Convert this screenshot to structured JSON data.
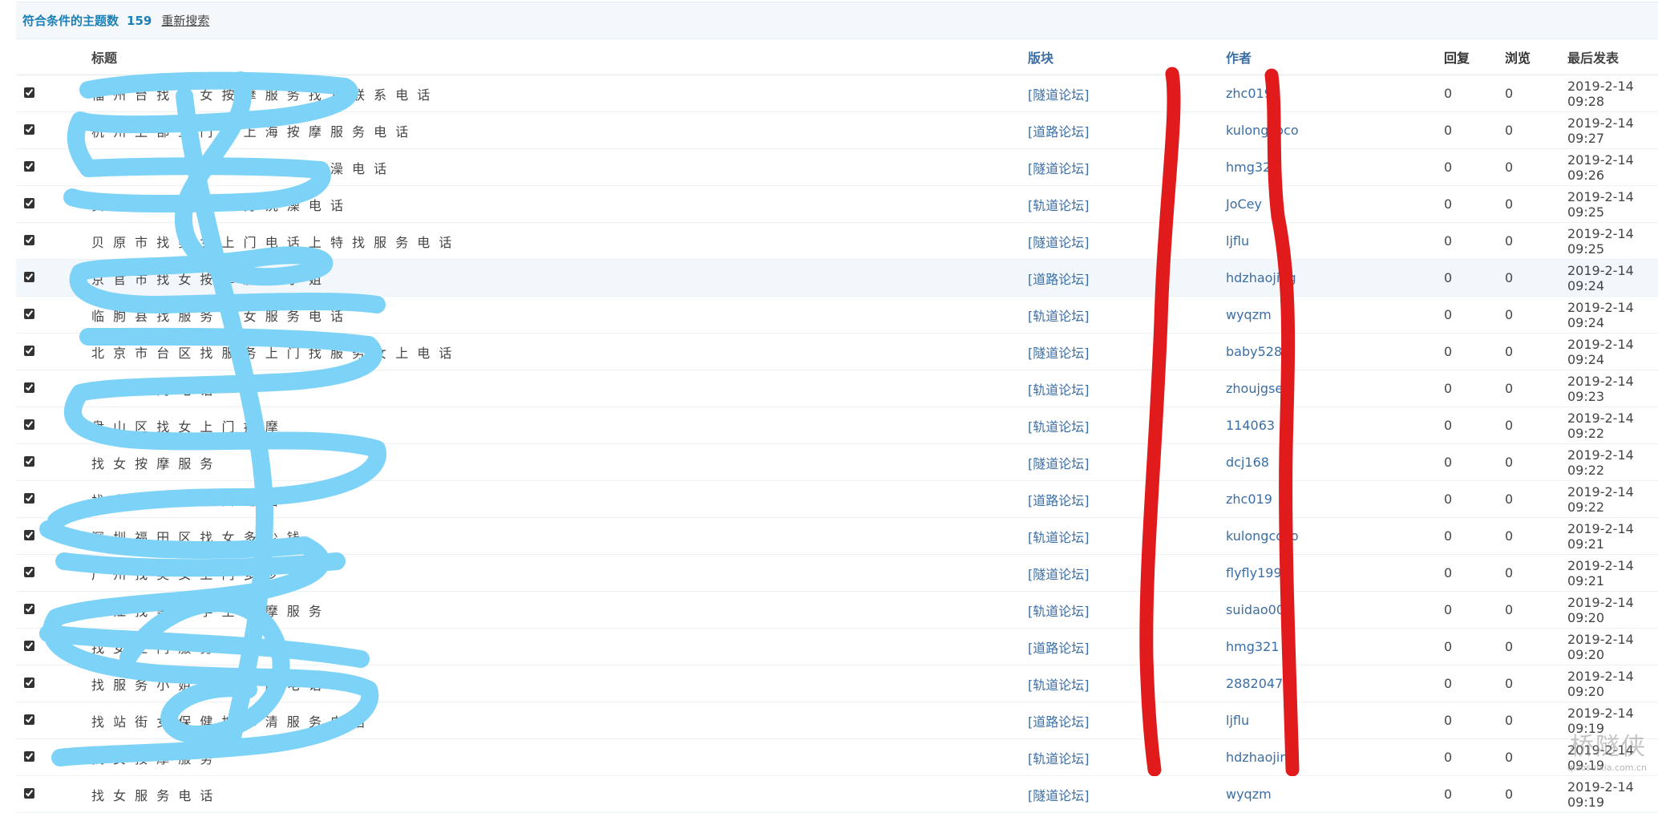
{
  "summary": {
    "label": "符合条件的主题数",
    "count": "159",
    "research_link": "重新搜索"
  },
  "headers": {
    "title": "标题",
    "forum": "版块",
    "author": "作者",
    "replies": "回复",
    "views": "浏览",
    "last_post": "最后发表"
  },
  "rows": [
    {
      "title": "福 州 台 找 美 女 按 摩 服 务 找 女 联 系 电 话",
      "forum": "[隧道论坛]",
      "author": "zhc019",
      "replies": "0",
      "views": "0",
      "last": "2019-2-14 09:28"
    },
    {
      "title": "杭 州 上 部 上 门 高 上 海 按 摩 服 务 电 话",
      "forum": "[道路论坛]",
      "author": "kulongcoco",
      "replies": "0",
      "views": "0",
      "last": "2019-2-14 09:27"
    },
    {
      "title": "长 治 找 服 务 站 街 女 按 摩 洗 澡 电 话",
      "forum": "[隧道论坛]",
      "author": "hmg321",
      "replies": "0",
      "views": "0",
      "last": "2019-2-14 09:26"
    },
    {
      "title": "贵 港 找 鸡 按 摩 服 务 洗 澡 电 话",
      "forum": "[轨道论坛]",
      "author": "JoCey",
      "replies": "0",
      "views": "0",
      "last": "2019-2-14 09:25"
    },
    {
      "title": "贝 原 市 找 美 女 上 门 电 话 上 特 找 服 务 电 话",
      "forum": "[隧道论坛]",
      "author": "ljflu",
      "replies": "0",
      "views": "0",
      "last": "2019-2-14 09:25"
    },
    {
      "title": "京 官 市 找 女 按 摩 服 务 小 姐",
      "forum": "[道路论坛]",
      "author": "hdzhaojing",
      "replies": "0",
      "views": "0",
      "last": "2019-2-14 09:24"
    },
    {
      "title": "临 朐 县 找 服 务 帮 女 服 务 电 话",
      "forum": "[轨道论坛]",
      "author": "wyqzm",
      "replies": "0",
      "views": "0",
      "last": "2019-2-14 09:24"
    },
    {
      "title": "北 京 市 台 区 找 服 务 上 门 找 服 务 女 上 电 话",
      "forum": "[隧道论坛]",
      "author": "baby528",
      "replies": "0",
      "views": "0",
      "last": "2019-2-14 09:24"
    },
    {
      "title": "保 女 上 门 电 话",
      "forum": "[轨道论坛]",
      "author": "zhoujgseu",
      "replies": "0",
      "views": "0",
      "last": "2019-2-14 09:23"
    },
    {
      "title": "盘 山 区 找 女 上 门 按 摩",
      "forum": "[轨道论坛]",
      "author": "114063",
      "replies": "0",
      "views": "0",
      "last": "2019-2-14 09:22"
    },
    {
      "title": "找 女 按 摩 服 务",
      "forum": "[隧道论坛]",
      "author": "dcj168",
      "replies": "0",
      "views": "0",
      "last": "2019-2-14 09:22"
    },
    {
      "title": "找 女 上 门 按 摩 女 电 话",
      "forum": "[道路论坛]",
      "author": "zhc019",
      "replies": "0",
      "views": "0",
      "last": "2019-2-14 09:22"
    },
    {
      "title": "深 圳 福 田 区 找 女 多 少 钱",
      "forum": "[轨道论坛]",
      "author": "kulongcoco",
      "replies": "0",
      "views": "0",
      "last": "2019-2-14 09:21"
    },
    {
      "title": "广 州 找 美 女 上 门 多 少 钱",
      "forum": "[隧道论坛]",
      "author": "flyfly1999",
      "replies": "0",
      "views": "0",
      "last": "2019-2-14 09:21"
    },
    {
      "title": "丽 江 找 美 女 学 生 按 摩 服 务",
      "forum": "[轨道论坛]",
      "author": "suidao007",
      "replies": "0",
      "views": "0",
      "last": "2019-2-14 09:20"
    },
    {
      "title": "找 女 上 门 服 务",
      "forum": "[道路论坛]",
      "author": "hmg321",
      "replies": "0",
      "views": "0",
      "last": "2019-2-14 09:20"
    },
    {
      "title": "找 服 务 小 姐 上 门 按 摩 电 话",
      "forum": "[轨道论坛]",
      "author": "2882047",
      "replies": "0",
      "views": "0",
      "last": "2019-2-14 09:20"
    },
    {
      "title": "找 站 街 女 保 健 按 摩 清 服 务 电 话",
      "forum": "[道路论坛]",
      "author": "ljflu",
      "replies": "0",
      "views": "0",
      "last": "2019-2-14 09:19"
    },
    {
      "title": "找 女 按 摩 服 务",
      "forum": "[轨道论坛]",
      "author": "hdzhaojing",
      "replies": "0",
      "views": "0",
      "last": "2019-2-14 09:19"
    },
    {
      "title": "找 女 服 务 电 话",
      "forum": "[隧道论坛]",
      "author": "wyqzm",
      "replies": "0",
      "views": "0",
      "last": "2019-2-14 09:19"
    }
  ],
  "watermark": {
    "name": "桥隧侠",
    "site": "qiaosuixia.com.cn"
  },
  "colors": {
    "blue_scribble": "#7dd3f7",
    "red_marker": "#e11b1b",
    "link": "#3a6ea5"
  }
}
